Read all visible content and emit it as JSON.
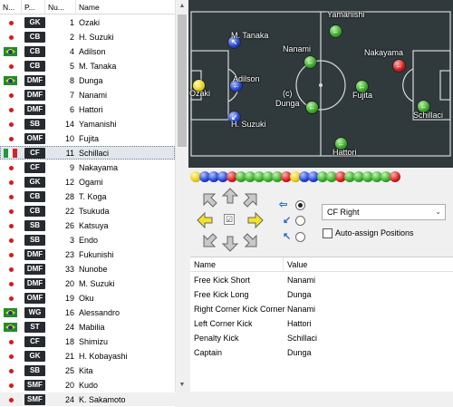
{
  "player_list": {
    "columns": [
      "N...",
      "P...",
      "Nu...",
      "Name"
    ],
    "players": [
      {
        "flag": "dot",
        "pos": "GK",
        "num": "1",
        "name": "Ozaki"
      },
      {
        "flag": "dot",
        "pos": "CB",
        "num": "2",
        "name": "H. Suzuki"
      },
      {
        "flag": "br",
        "pos": "CB",
        "num": "4",
        "name": "Adilson"
      },
      {
        "flag": "dot",
        "pos": "CB",
        "num": "5",
        "name": "M. Tanaka"
      },
      {
        "flag": "br",
        "pos": "DMF",
        "num": "8",
        "name": "Dunga"
      },
      {
        "flag": "dot",
        "pos": "DMF",
        "num": "7",
        "name": "Nanami"
      },
      {
        "flag": "dot",
        "pos": "DMF",
        "num": "6",
        "name": "Hattori"
      },
      {
        "flag": "dot",
        "pos": "SB",
        "num": "14",
        "name": "Yamanishi"
      },
      {
        "flag": "dot",
        "pos": "OMF",
        "num": "10",
        "name": "Fujita"
      },
      {
        "flag": "it",
        "pos": "CF",
        "num": "11",
        "name": "Schillaci",
        "selected": true
      },
      {
        "flag": "dot",
        "pos": "CF",
        "num": "9",
        "name": "Nakayama"
      },
      {
        "flag": "dot",
        "pos": "GK",
        "num": "12",
        "name": "Ogami"
      },
      {
        "flag": "dot",
        "pos": "CB",
        "num": "28",
        "name": "T. Koga"
      },
      {
        "flag": "dot",
        "pos": "CB",
        "num": "22",
        "name": "Tsukuda"
      },
      {
        "flag": "dot",
        "pos": "SB",
        "num": "26",
        "name": "Katsuya"
      },
      {
        "flag": "dot",
        "pos": "SB",
        "num": "3",
        "name": "Endo"
      },
      {
        "flag": "dot",
        "pos": "DMF",
        "num": "23",
        "name": "Fukunishi"
      },
      {
        "flag": "dot",
        "pos": "DMF",
        "num": "33",
        "name": "Nunobe"
      },
      {
        "flag": "dot",
        "pos": "DMF",
        "num": "20",
        "name": "M. Suzuki"
      },
      {
        "flag": "dot",
        "pos": "OMF",
        "num": "19",
        "name": "Oku"
      },
      {
        "flag": "br",
        "pos": "WG",
        "num": "16",
        "name": "Alessandro"
      },
      {
        "flag": "br",
        "pos": "ST",
        "num": "24",
        "name": "Mabilia"
      },
      {
        "flag": "dot",
        "pos": "CF",
        "num": "18",
        "name": "Shimizu"
      },
      {
        "flag": "dot",
        "pos": "GK",
        "num": "21",
        "name": "H. Kobayashi"
      },
      {
        "flag": "dot",
        "pos": "SB",
        "num": "25",
        "name": "Kita"
      },
      {
        "flag": "dot",
        "pos": "SMF",
        "num": "20",
        "name": "Kudo"
      },
      {
        "flag": "dot",
        "pos": "SMF",
        "num": "24",
        "name": "K. Sakamoto"
      }
    ]
  },
  "pitch": {
    "players": [
      {
        "label": "Ozaki",
        "color": "y",
        "arrow": "←"
      },
      {
        "label": "M. Tanaka",
        "color": "b",
        "arrow": "↖"
      },
      {
        "label": "Adilson",
        "color": "b",
        "arrow": "←"
      },
      {
        "label": "H. Suzuki",
        "color": "b",
        "arrow": "↙"
      },
      {
        "label": "Nanami",
        "color": "g",
        "arrow": "←"
      },
      {
        "label": "(c)",
        "color": "g",
        "arrow": "←"
      },
      {
        "label": "Dunga",
        "color": "g",
        "arrow": "←"
      },
      {
        "label": "Yamanishi",
        "color": "g",
        "arrow": "←"
      },
      {
        "label": "Fujita",
        "color": "g",
        "arrow": "←"
      },
      {
        "label": "Nakayama",
        "color": "r",
        "arrow": "←"
      },
      {
        "label": "Schillaci",
        "color": "g",
        "arrow": "←"
      },
      {
        "label": "Hattori",
        "color": "g",
        "arrow": "←"
      }
    ]
  },
  "ball_row": [
    "y",
    "b",
    "b",
    "b",
    "r",
    "g",
    "g",
    "g",
    "g",
    "g",
    "r",
    "y",
    "b",
    "b",
    "g",
    "g",
    "r",
    "g",
    "g",
    "g",
    "g",
    "g",
    "r"
  ],
  "controls": {
    "center_symbol": "☑",
    "position_select_value": "CF Right",
    "auto_assign_label": "Auto-assign Positions"
  },
  "set_pieces": {
    "headers": [
      "Name",
      "Value"
    ],
    "rows": [
      {
        "name": "Free Kick Short",
        "value": "Nanami"
      },
      {
        "name": "Free Kick Long",
        "value": "Dunga"
      },
      {
        "name": "Right Corner Kick Corner",
        "value": "Nanami"
      },
      {
        "name": "Left Corner Kick",
        "value": "Hattori"
      },
      {
        "name": "Penalty Kick",
        "value": "Schillaci"
      },
      {
        "name": "Captain",
        "value": "Dunga"
      }
    ]
  },
  "colors": {
    "pitch_bg": "#303a3d",
    "selected_row": "#e3e7ec",
    "position_badge": "#272b30"
  }
}
